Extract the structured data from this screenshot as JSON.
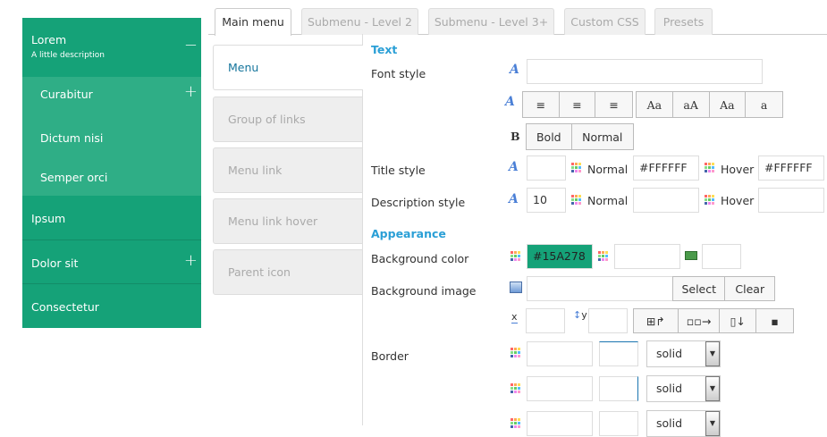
{
  "menu": {
    "top": {
      "label": "Lorem",
      "desc": "A little description"
    },
    "sub": [
      "Curabitur",
      "Dictum nisi",
      "Semper orci"
    ],
    "items": [
      "Ipsum",
      "Dolor sit",
      "Consectetur"
    ]
  },
  "tabs": [
    "Main menu",
    "Submenu - Level 2",
    "Submenu - Level 3+",
    "Custom CSS",
    "Presets"
  ],
  "vtabs": [
    "Menu",
    "Group of links",
    "Menu link",
    "Menu link hover",
    "Parent icon"
  ],
  "form": {
    "text_heading": "Text",
    "font_style": "Font style",
    "bold": "Bold",
    "normal": "Normal",
    "title_style": "Title style",
    "desc_style": "Description style",
    "normal_lbl": "Normal",
    "hover_lbl": "Hover",
    "title_normal": "#FFFFFF",
    "title_hover": "#FFFFFF",
    "desc_size": "10",
    "appearance": "Appearance",
    "bg_color": "Background color",
    "bg_color_value": "#15A278",
    "bg_image": "Background image",
    "select": "Select",
    "clear": "Clear",
    "x": "x",
    "y": "y",
    "border": "Border",
    "border_style": "solid"
  },
  "colors": {
    "accent": "#15A278"
  }
}
